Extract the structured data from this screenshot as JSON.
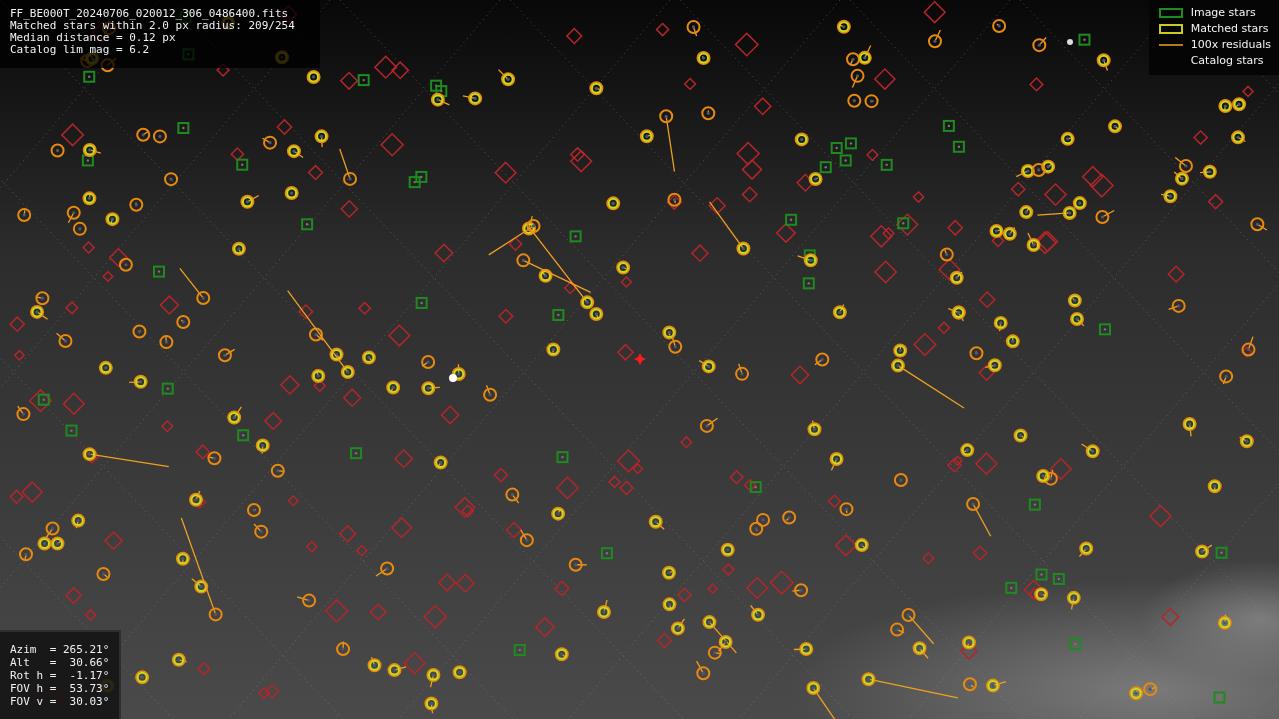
{
  "info_box": {
    "lines": [
      "FF_BE000T_20240706_020012_306_0486400.fits",
      "Matched stars within 2.0 px radius: 209/254",
      "Median distance = 0.12 px",
      "Catalog lim mag = 6.2"
    ]
  },
  "legend": [
    {
      "kind": "image",
      "label": "Image stars"
    },
    {
      "kind": "matched",
      "label": "Matched stars"
    },
    {
      "kind": "residual",
      "label": "100x residuals"
    },
    {
      "kind": "catalog",
      "label": "Catalog stars"
    }
  ],
  "pointing_box": {
    "lines": [
      "Azim  = 265.21°",
      "Alt   =  30.66°",
      "Rot h =  -1.17°",
      "FOV h =  53.73°",
      "FOV v =  30.03°"
    ]
  }
}
